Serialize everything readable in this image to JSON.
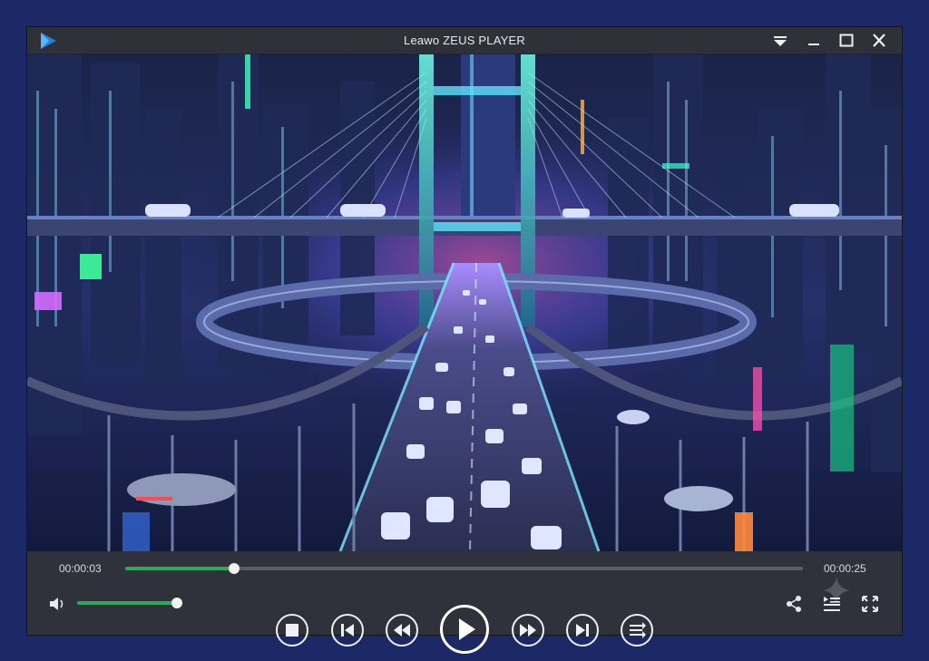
{
  "window": {
    "title": "Leawo ZEUS PLAYER",
    "controls": [
      "menu-dropdown-icon",
      "minimize-icon",
      "maximize-icon",
      "close-icon"
    ]
  },
  "video": {
    "scene": "futuristic-city-bridge"
  },
  "playback": {
    "elapsed": "00:00:03",
    "total": "00:00:25",
    "progress_fraction": 0.16,
    "volume_fraction": 1.0
  },
  "controls": {
    "buttons": [
      "stop-icon",
      "previous-icon",
      "rewind-icon",
      "play-icon",
      "fast-forward-icon",
      "next-icon",
      "playlist-mode-icon"
    ],
    "right_buttons": [
      "share-icon",
      "playlist-icon",
      "fullscreen-icon"
    ]
  },
  "colors": {
    "accent": "#2fa857",
    "background": "#1d2867",
    "panel": "#2f323a",
    "titlebar": "#2e3138"
  }
}
